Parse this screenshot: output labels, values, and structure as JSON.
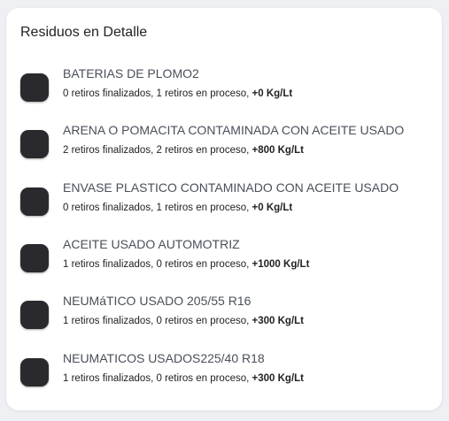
{
  "card": {
    "title": "Residuos en Detalle"
  },
  "items": [
    {
      "name": "BATERIAS DE PLOMO2",
      "finalized": "0 retiros finalizados,",
      "in_process": "1 retiros en proceso,",
      "amount": "+0 Kg/Lt"
    },
    {
      "name": "ARENA O POMACITA CONTAMINADA CON ACEITE USADO",
      "finalized": "2 retiros finalizados,",
      "in_process": "2 retiros en proceso,",
      "amount": "+800 Kg/Lt"
    },
    {
      "name": "ENVASE PLASTICO CONTAMINADO CON ACEITE USADO",
      "finalized": "0 retiros finalizados,",
      "in_process": "1 retiros en proceso,",
      "amount": "+0 Kg/Lt"
    },
    {
      "name": "ACEITE USADO AUTOMOTRIZ",
      "finalized": "1 retiros finalizados,",
      "in_process": "0 retiros en proceso,",
      "amount": "+1000 Kg/Lt"
    },
    {
      "name": "NEUMáTICO USADO 205/55 R16",
      "finalized": "1 retiros finalizados,",
      "in_process": "0 retiros en proceso,",
      "amount": "+300 Kg/Lt"
    },
    {
      "name": "NEUMATICOS USADOS225/40 R18",
      "finalized": "1 retiros finalizados,",
      "in_process": "0 retiros en proceso,",
      "amount": "+300 Kg/Lt"
    }
  ]
}
